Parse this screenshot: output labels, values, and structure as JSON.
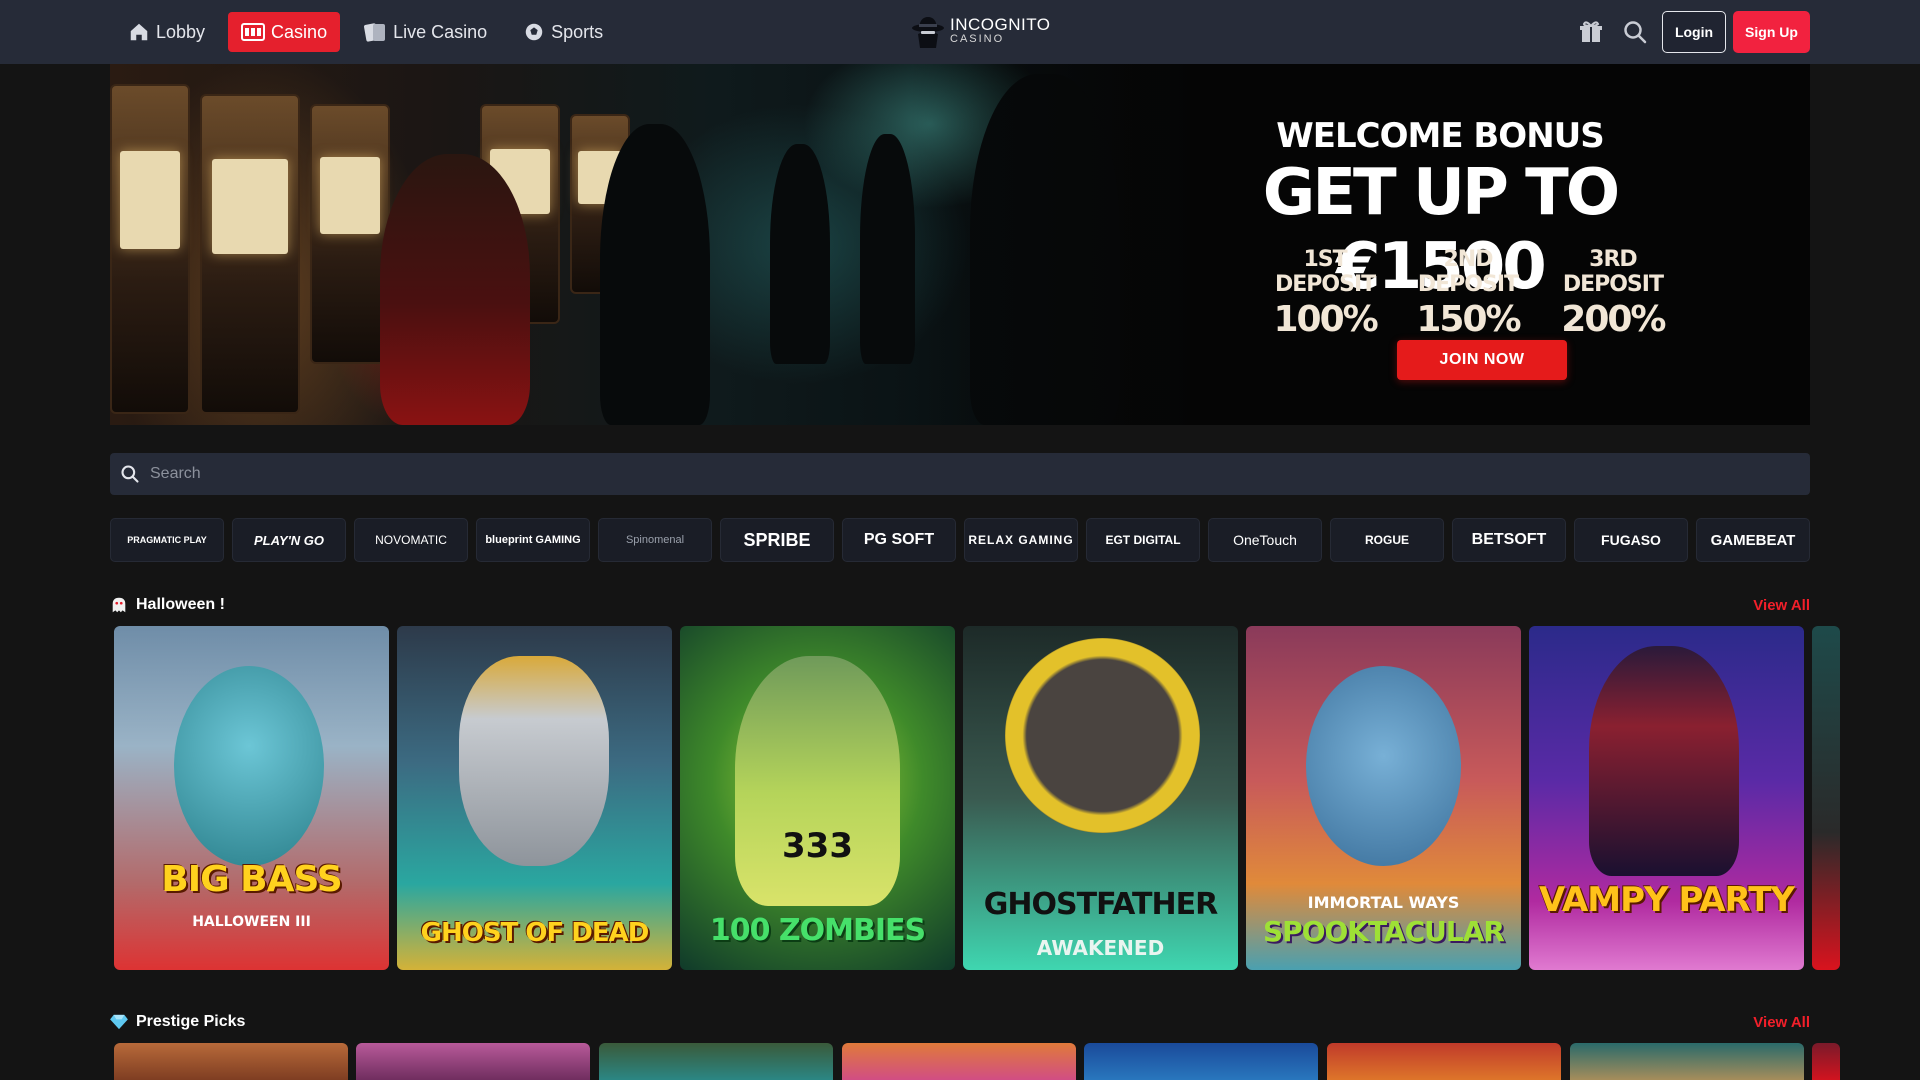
{
  "nav": {
    "items": [
      {
        "label": "Lobby",
        "icon": "home-icon",
        "active": false
      },
      {
        "label": "Casino",
        "icon": "slot-machine-icon",
        "active": true
      },
      {
        "label": "Live Casino",
        "icon": "cards-icon",
        "active": false
      },
      {
        "label": "Sports",
        "icon": "sports-ball-icon",
        "active": false
      }
    ]
  },
  "logo": {
    "main": "INCOGNITO",
    "sub": "CASINO"
  },
  "header": {
    "login_label": "Login",
    "signup_label": "Sign Up"
  },
  "hero": {
    "title": "WELCOME BONUS",
    "amount": "GET UP TO €1500",
    "deposits": [
      {
        "label": "1ST DEPOSIT",
        "percent": "100%"
      },
      {
        "label": "2ND DEPOSIT",
        "percent": "150%"
      },
      {
        "label": "3RD DEPOSIT",
        "percent": "200%"
      }
    ],
    "cta": "JOIN NOW"
  },
  "search": {
    "placeholder": "Search"
  },
  "providers": [
    "PRAGMATIC PLAY",
    "PLAY'N GO",
    "NOVOMATIC",
    "blueprint GAMING",
    "Spinomenal",
    "SPRIBE",
    "PG SOFT",
    "RELAX GAMING",
    "EGT DIGITAL",
    "OneTouch",
    "ROGUE",
    "BETSOFT",
    "FUGASO",
    "GAMEBEAT"
  ],
  "sections": [
    {
      "title": "Halloween !",
      "view_all": "View All",
      "icon": "ghost-icon"
    },
    {
      "title": "Prestige Picks",
      "view_all": "View All",
      "icon": "diamond-icon"
    }
  ],
  "halloween_games": [
    {
      "title": "BIG BASS",
      "subtitle": "HALLOWEEN III"
    },
    {
      "title": "GHOST OF DEAD",
      "subtitle": ""
    },
    {
      "title": "100 ZOMBIES",
      "subtitle": "333"
    },
    {
      "title": "GHOSTFATHER",
      "subtitle": "AWAKENED"
    },
    {
      "title": "SPOOKTACULAR",
      "subtitle": "IMMORTAL WAYS"
    },
    {
      "title": "VAMPY PARTY",
      "subtitle": ""
    }
  ],
  "colors": {
    "accent": "#e5202d",
    "signup": "#f2223f",
    "topbar": "#262b38",
    "background": "#141414",
    "view_all": "#f21f2a"
  }
}
